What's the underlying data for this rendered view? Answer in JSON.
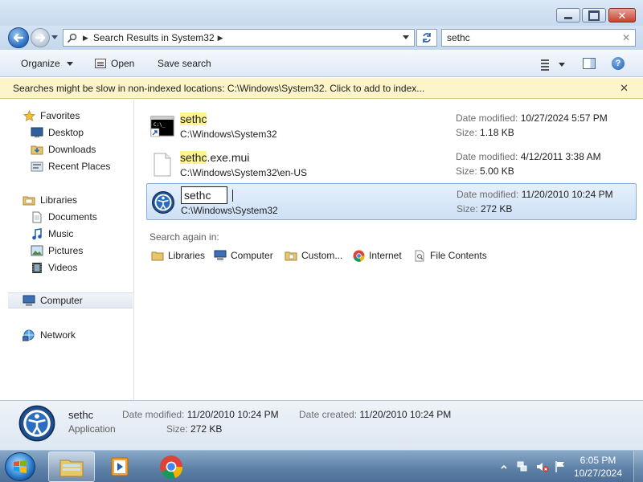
{
  "window": {
    "close_glyph": "✕"
  },
  "address": {
    "breadcrumb": "Search Results in System32",
    "chevron": "▶",
    "search_value": "sethc",
    "clear_glyph": "✕"
  },
  "toolbar": {
    "organize": "Organize",
    "open": "Open",
    "save_search": "Save search",
    "help": "?"
  },
  "infobar": {
    "text": "Searches might be slow in non-indexed locations: C:\\Windows\\System32. Click to add to index...",
    "close_glyph": "✕"
  },
  "nav": {
    "favorites": "Favorites",
    "desktop": "Desktop",
    "downloads": "Downloads",
    "recent_places": "Recent Places",
    "libraries": "Libraries",
    "documents": "Documents",
    "music": "Music",
    "pictures": "Pictures",
    "videos": "Videos",
    "computer": "Computer",
    "network": "Network"
  },
  "results": [
    {
      "name_hl": "sethc",
      "name_rest": "",
      "path": "C:\\Windows\\System32",
      "date_label": "Date modified:",
      "date": "10/27/2024 5:57 PM",
      "size_label": "Size:",
      "size": "1.18 KB",
      "icon": "cmd-shortcut-icon"
    },
    {
      "name_hl": "sethc",
      "name_rest": ".exe.mui",
      "path": "C:\\Windows\\System32\\en-US",
      "date_label": "Date modified:",
      "date": "4/12/2011 3:38 AM",
      "size_label": "Size:",
      "size": "5.00 KB",
      "icon": "blank-file-icon"
    },
    {
      "name": "sethc",
      "path": "C:\\Windows\\System32",
      "date_label": "Date modified:",
      "date": "11/20/2010 10:24 PM",
      "size_label": "Size:",
      "size": "272 KB",
      "icon": "accessibility-icon",
      "selected": true,
      "renaming": true
    }
  ],
  "search_again": {
    "label": "Search again in:",
    "libraries": "Libraries",
    "computer": "Computer",
    "custom": "Custom...",
    "internet": "Internet",
    "file_contents": "File Contents"
  },
  "details": {
    "name": "sethc",
    "type": "Application",
    "modified_label": "Date modified:",
    "modified": "11/20/2010 10:24 PM",
    "created_label": "Date created:",
    "created": "11/20/2010 10:24 PM",
    "size_label": "Size:",
    "size": "272 KB"
  },
  "taskbar": {
    "time": "6:05 PM",
    "date": "10/27/2024"
  },
  "colors": {
    "highlight": "#fdf391",
    "selection": "#cde0f6",
    "infobar": "#fdf5c9",
    "taskbar": "#5b7fa6"
  }
}
